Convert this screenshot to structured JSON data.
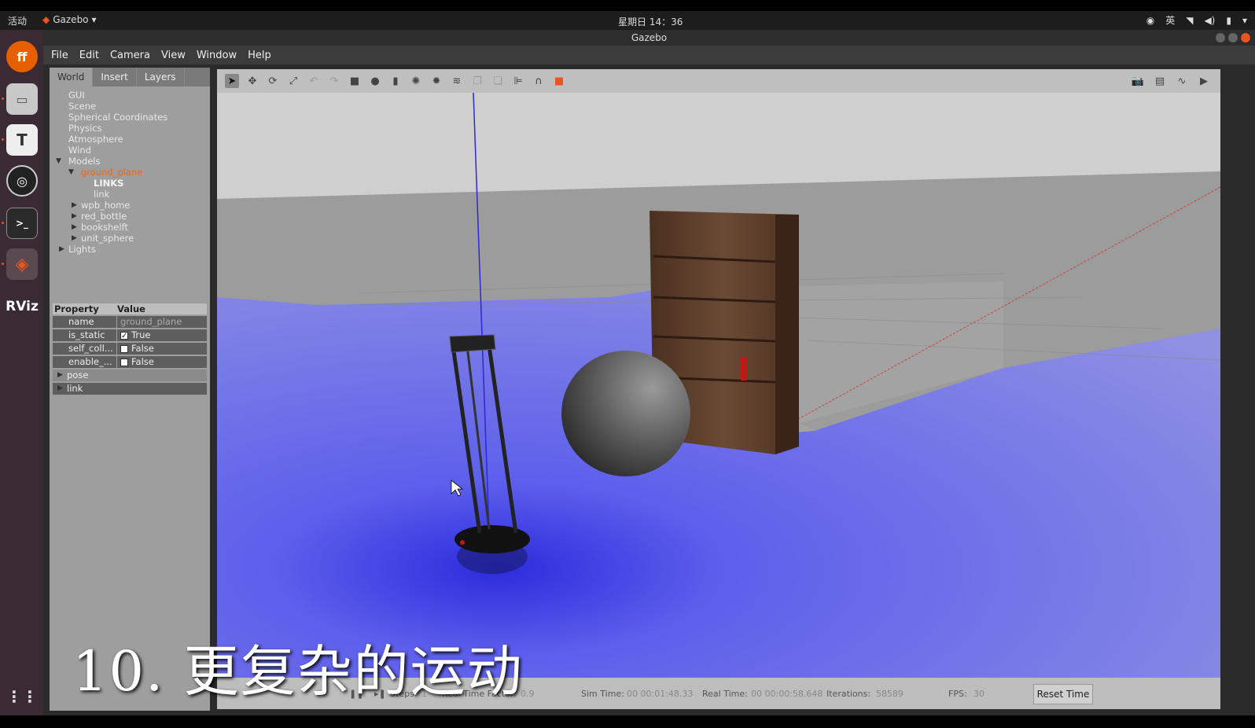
{
  "topbar": {
    "activities": "活动",
    "app_name": "Gazebo",
    "clock": "星期日 14：36",
    "input_method": "英"
  },
  "window": {
    "title": "Gazebo"
  },
  "menu": {
    "file": "File",
    "edit": "Edit",
    "camera": "Camera",
    "view": "View",
    "window": "Window",
    "help": "Help"
  },
  "tabs": {
    "world": "World",
    "insert": "Insert",
    "layers": "Layers"
  },
  "tree": {
    "gui": "GUI",
    "scene": "Scene",
    "spherical": "Spherical Coordinates",
    "physics": "Physics",
    "atmosphere": "Atmosphere",
    "wind": "Wind",
    "models": "Models",
    "ground_plane": "ground_plane",
    "links": "LINKS",
    "link": "link",
    "wpb_home": "wpb_home",
    "red_bottle": "red_bottle",
    "bookshelf": "bookshelft",
    "unit_sphere": "unit_sphere",
    "lights": "Lights"
  },
  "properties": {
    "header_property": "Property",
    "header_value": "Value",
    "name_key": "name",
    "name_val": "ground_plane",
    "is_static_key": "is_static",
    "is_static_val": "True",
    "self_collide_key": "self_coll...",
    "self_collide_val": "False",
    "enable_key": "enable_...",
    "enable_val": "False",
    "pose": "pose",
    "link": "link"
  },
  "status": {
    "steps_label": "Steps:",
    "steps_val": "1",
    "rtf_label": "Real Time Factor:",
    "rtf_val": "0.9",
    "sim_time_label": "Sim Time:",
    "sim_time_val": "00 00:01:48.33",
    "real_time_label": "Real Time:",
    "real_time_val": "00 00:00:58.648",
    "iterations_label": "Iterations:",
    "iterations_val": "58589",
    "fps_label": "FPS:",
    "fps_val": "30",
    "reset_time": "Reset Time"
  },
  "caption": "10. 更复杂的运动",
  "colors": {
    "laser": "#5a5cf0",
    "selected": "#e06a1f",
    "ubuntu_orange": "#e95420"
  }
}
